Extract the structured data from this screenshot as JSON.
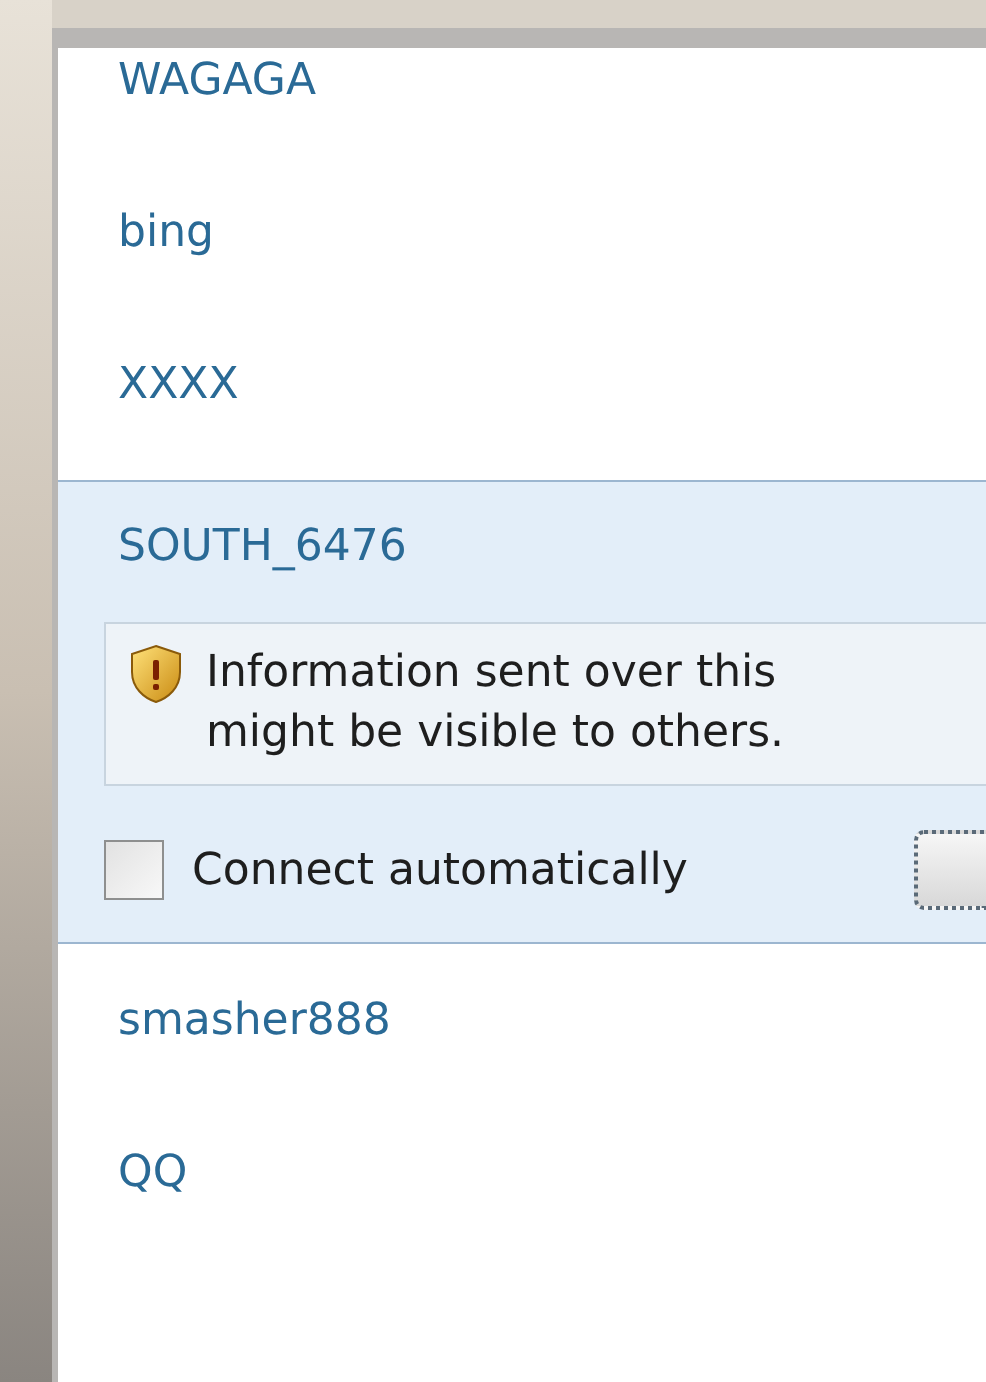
{
  "networks": [
    {
      "name": "WAGAGA",
      "selected": false
    },
    {
      "name": "bing",
      "selected": false
    },
    {
      "name": "XXXX",
      "selected": false
    },
    {
      "name": "SOUTH_6476",
      "selected": true,
      "warning_lines": [
        "Information sent over this",
        "might be visible to others."
      ],
      "connect_automatically": {
        "label": "Connect automatically",
        "checked": false
      }
    },
    {
      "name": "smasher888",
      "selected": false
    },
    {
      "name": "QQ",
      "selected": false
    }
  ]
}
